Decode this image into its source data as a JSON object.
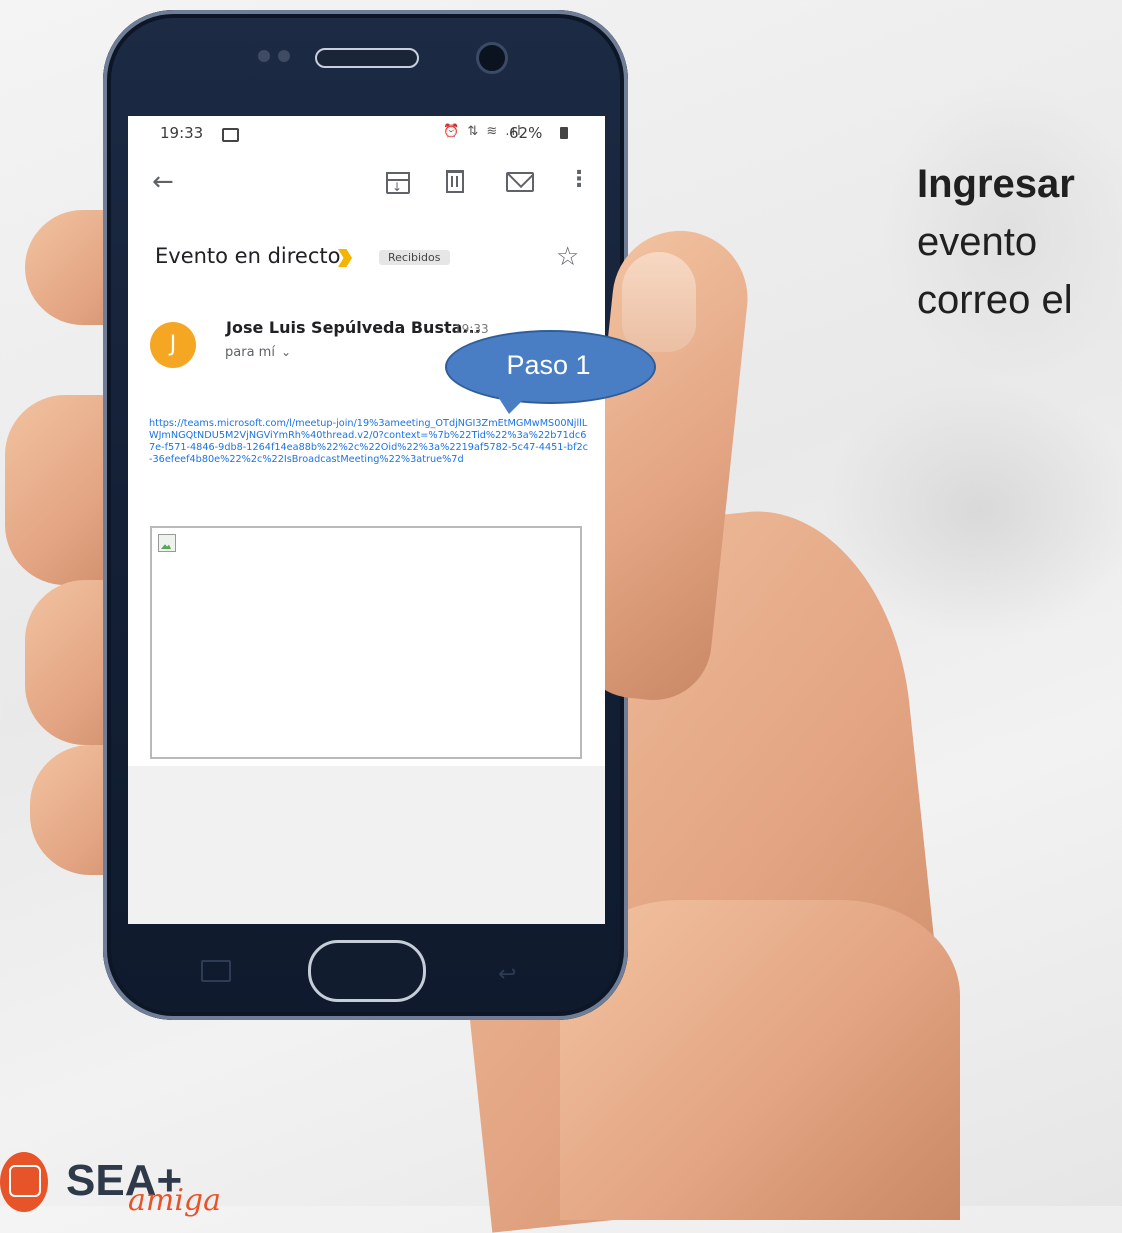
{
  "side_text": {
    "bold": "Ingresar",
    "line2": "evento",
    "line3": "correo el"
  },
  "callout": {
    "label": "Paso 1"
  },
  "status_bar": {
    "time": "19:33",
    "icons": "⏰ ⇅ ≋ .ıl",
    "battery": "62%"
  },
  "toolbar": {
    "icons": [
      "back-arrow-icon",
      "archive-icon",
      "delete-icon",
      "mark-unread-icon",
      "more-options-icon"
    ]
  },
  "email": {
    "subject": "Evento en directo",
    "label": "Recibidos",
    "sender_initial": "J",
    "sender": "Jose Luis Sepúlveda Busta...",
    "time": "19:33",
    "to": "para mí",
    "link": "https://teams.microsoft.com/l/meetup-join/19%3ameeting_OTdjNGI3ZmEtMGMwMS00NjllLWJmNGQtNDU5M2VjNGViYmRh%40thread.v2/0?context=%7b%22Tid%22%3a%22b71dc67e-f571-4846-9db8-1264f14ea88b%22%2c%22Oid%22%3a%2219af5782-5c47-4451-bf2c-36efeef4b80e%22%2c%22IsBroadcastMeeting%22%3atrue%7d"
  },
  "logo": {
    "text": "SEA+",
    "script": "amiga"
  },
  "colors": {
    "avatar": "#f5a623",
    "importance": "#f4b400",
    "link": "#1a73e8",
    "callout": "#4a7ec4",
    "logo_accent": "#e8542a"
  }
}
